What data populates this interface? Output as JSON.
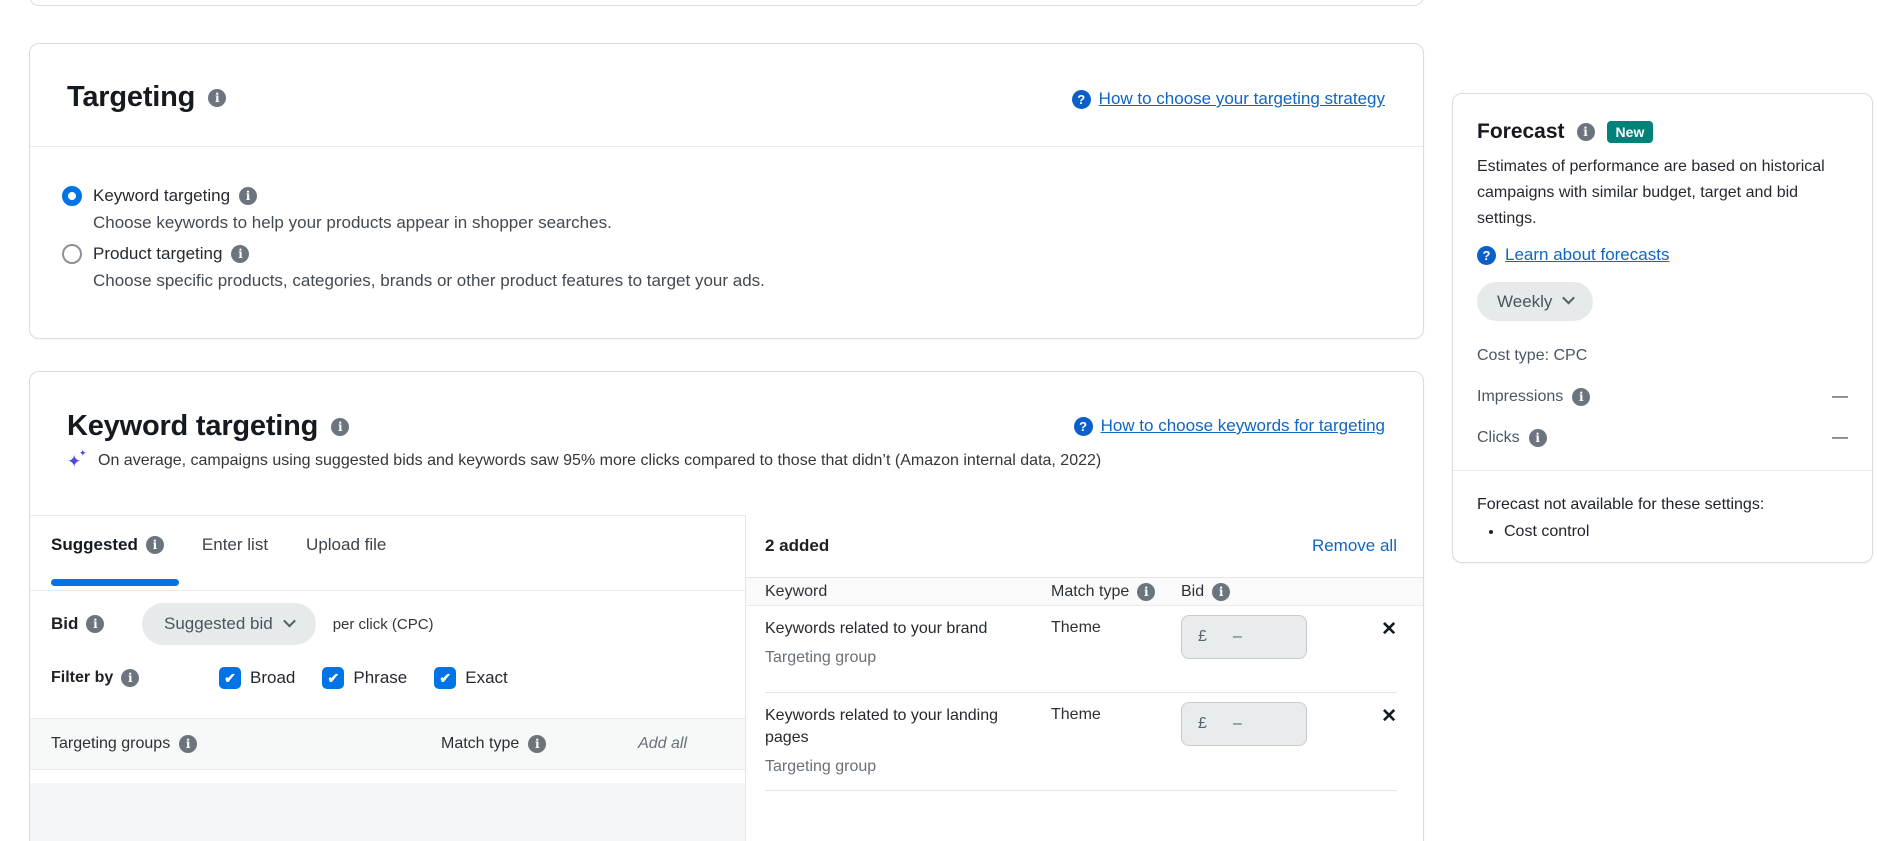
{
  "colors": {
    "link_blue": "#0f66c5",
    "control_blue": "#0073e6",
    "badge_teal": "#00827a",
    "sparkle_purple": "#4f46e5"
  },
  "targeting_card": {
    "title": "Targeting",
    "help_link": "How to choose your targeting strategy",
    "options": [
      {
        "label": "Keyword targeting",
        "selected": true,
        "description": "Choose keywords to help your products appear in shopper searches."
      },
      {
        "label": "Product targeting",
        "selected": false,
        "description": "Choose specific products, categories, brands or other product features to target your ads."
      }
    ]
  },
  "keyword_card": {
    "title": "Keyword targeting",
    "help_link": "How to choose keywords for targeting",
    "tip": "On average, campaigns using suggested bids and keywords saw 95% more clicks compared to those that didn’t (Amazon internal data, 2022)",
    "tabs": [
      {
        "label": "Suggested",
        "active": true
      },
      {
        "label": "Enter list",
        "active": false
      },
      {
        "label": "Upload file",
        "active": false
      }
    ],
    "bid": {
      "label": "Bid",
      "dropdown_value": "Suggested bid",
      "suffix": "per click (CPC)"
    },
    "filter": {
      "label": "Filter by",
      "options": [
        "Broad",
        "Phrase",
        "Exact"
      ],
      "check_glyph": "✔"
    },
    "suggestions_header": {
      "col1": "Targeting groups",
      "col2": "Match type",
      "action": "Add all"
    },
    "added": {
      "count_label": "2 added",
      "remove_all_label": "Remove all",
      "columns": [
        "Keyword",
        "Match type",
        "Bid"
      ],
      "close_glyph": "✕",
      "rows": [
        {
          "title": "Keywords related to your brand",
          "subtitle": "Targeting group",
          "match_type": "Theme",
          "currency": "£",
          "bid_value": "–"
        },
        {
          "title": "Keywords related to your landing pages",
          "subtitle": "Targeting group",
          "match_type": "Theme",
          "currency": "£",
          "bid_value": "–"
        }
      ]
    }
  },
  "forecast_card": {
    "title": "Forecast",
    "badge": "New",
    "description": "Estimates of performance are based on historical campaigns with similar budget, target and bid settings.",
    "learn_link": "Learn about forecasts",
    "period_dropdown": "Weekly",
    "cost_type": "Cost type: CPC",
    "metrics": [
      {
        "label": "Impressions",
        "value": "—"
      },
      {
        "label": "Clicks",
        "value": "—"
      }
    ],
    "unavailable_note": "Forecast not available for these settings:",
    "unavailable_reasons": [
      "Cost control"
    ]
  }
}
